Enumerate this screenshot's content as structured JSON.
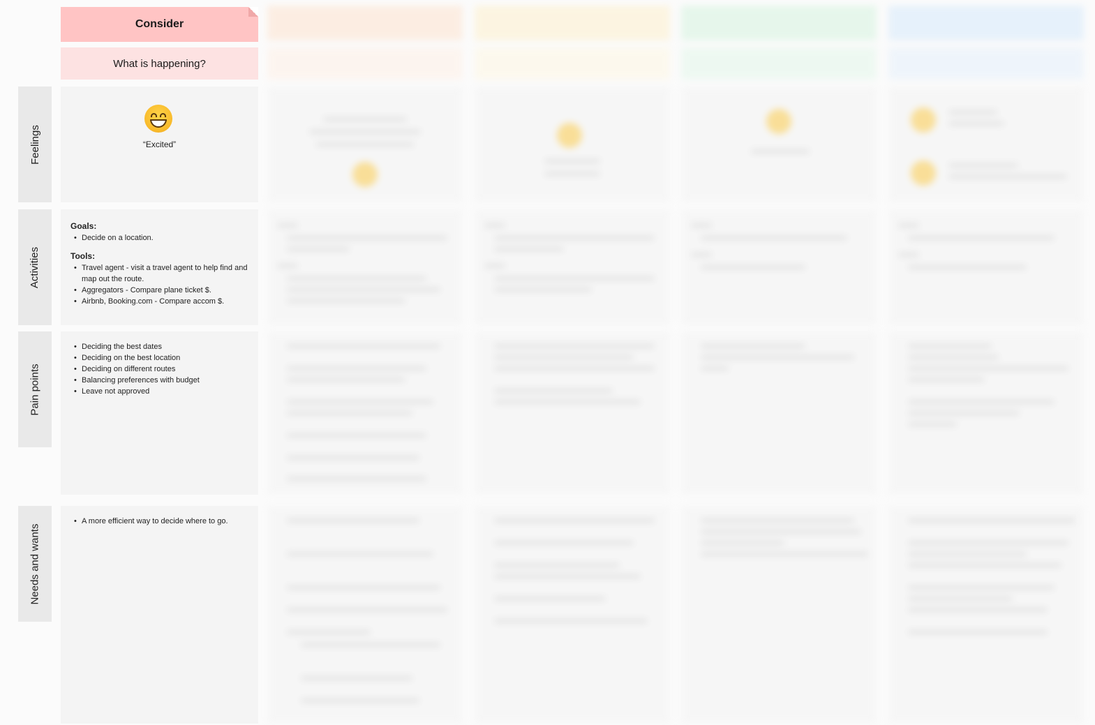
{
  "stage": {
    "title": "Consider",
    "subtitle": "What is happening?"
  },
  "rows": {
    "feelings": "Feelings",
    "activities": "Activities",
    "pain_points": "Pain points",
    "needs": "Needs and wants"
  },
  "feelings": {
    "emoji": "grinning-face-icon",
    "quote": "“Excited”"
  },
  "activities": {
    "goals_heading": "Goals:",
    "goals": [
      "Decide on a location."
    ],
    "tools_heading": "Tools:",
    "tools": [
      "Travel agent - visit a travel agent to help find and map out the route.",
      "Aggregators - Compare plane ticket $.",
      "Airbnb, Booking.com - Compare accom $."
    ]
  },
  "pain_points": [
    "Deciding the best dates",
    "Deciding on the best location",
    "Deciding on different routes",
    "Balancing preferences with budget",
    "Leave not approved"
  ],
  "needs": [
    "A more efficient way to decide where to go."
  ],
  "colors": {
    "consider_header": "#ffc4c4",
    "consider_sub": "#fde2e2",
    "col2": "#fde3cf",
    "col3": "#fdf0cc",
    "col4": "#d5f3df",
    "col5": "#d6e9fb",
    "cell_bg": "#f4f4f4",
    "label_bg": "#e9e9e9"
  }
}
